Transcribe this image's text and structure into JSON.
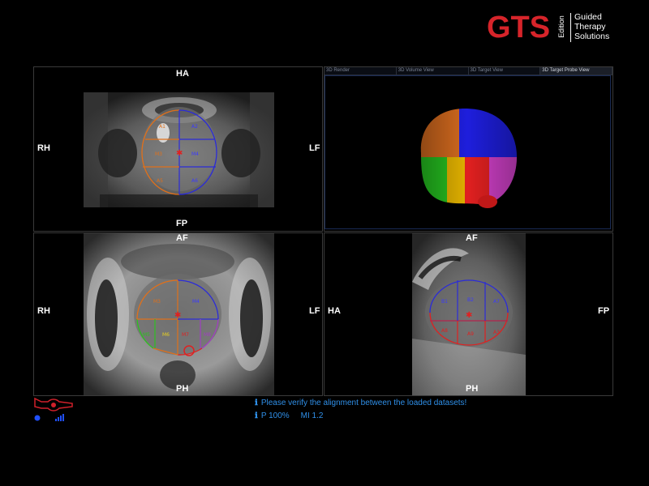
{
  "logo": {
    "brand": "GTS",
    "edition": "Edition",
    "tagline": [
      "Guided",
      "Therapy",
      "Solutions"
    ]
  },
  "tabs": [
    "3D Render",
    "3D Volume View",
    "3D Target View",
    "3D Target Probe View"
  ],
  "active_tab": "3D Target Probe View",
  "viewports": {
    "axial": {
      "top": "HA",
      "bottom": "FP",
      "left": "RH",
      "right": "LF",
      "zones": [
        "A1",
        "A2",
        "M3",
        "M4",
        "A5",
        "A6"
      ]
    },
    "coronal": {
      "top": "AF",
      "bottom": "PH",
      "left": "RH",
      "right": "LF",
      "zones": [
        "M3",
        "M4",
        "M5",
        "M6",
        "M7",
        "M8"
      ]
    },
    "sagittal": {
      "top": "AF",
      "bottom": "PH",
      "left": "HA",
      "right": "FP",
      "zones": [
        "B1",
        "B2",
        "A7",
        "A8",
        "A9",
        "A3"
      ]
    }
  },
  "status": {
    "message": "Please verify the alignment between the loaded datasets!",
    "power": "P 100%",
    "mi": "MI 1.2"
  },
  "colors": {
    "brand_red": "#d6242a",
    "status_blue": "#2f8fe8",
    "zone_blue": "#2b2bd8",
    "zone_orange": "#e0701a",
    "zone_red": "#e02020",
    "zone_green": "#2ec020",
    "zone_purple": "#a040c0",
    "zone_yellow": "#e8d020"
  },
  "icons": [
    "ultrasound-probe-icon",
    "indicator-dot-icon",
    "signal-bars-icon",
    "info-icon"
  ]
}
